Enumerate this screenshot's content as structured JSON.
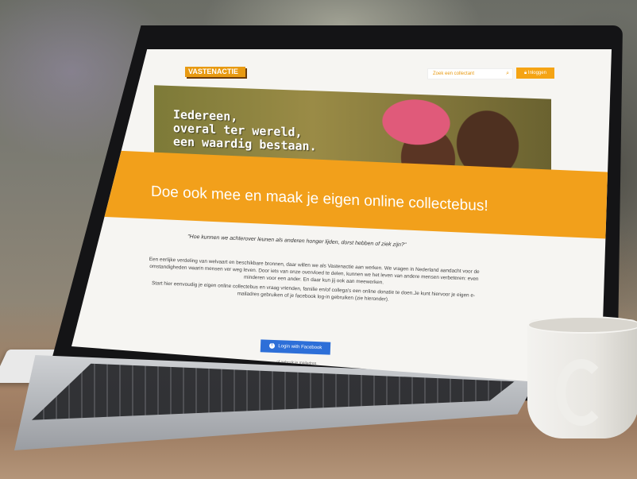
{
  "site": {
    "logo_text": "VASTENACTIE",
    "search_placeholder": "Zoek een collectant",
    "login_label": "Inloggen"
  },
  "hero": {
    "line1": "Iedereen,",
    "line2": "overal ter wereld,",
    "line3": "een waardig bestaan."
  },
  "headline": "Doe ook mee en maak je eigen online collectebus!",
  "quote": "\"Hoe kunnen we achterover leunen als anderen honger lijden, dorst hebben of ziek zijn?\"",
  "body_text": {
    "paragraph1": "Een eerlijke verdeling van welvaart en beschikbare bronnen, daar willen we als Vastenactie aan werken. We vragen in Nederland aandacht voor de omstandigheden waarin mensen ver weg leven. Door iets van onze overvloed te delen, kunnen we het leven van andere mensen verbeteren: even minderen voor een ander. En daar kun jij ook aan meewerken.",
    "paragraph2": "Start hier eenvoudig je eigen online collectebus en vraag vrienden, familie en/of collega's een online donatie te doen.Je kunt hiervoor je eigen e-mailadres gebruiken of je facebook log-in gebruiken (zie hieronder)."
  },
  "facebook_button": "Login with Facebook",
  "alt_link": "of gebruik je mailadres",
  "icons": {
    "search": "search-icon",
    "lock": "lock-icon",
    "facebook": "facebook-icon"
  },
  "colors": {
    "brand_orange": "#f2a01b",
    "facebook_blue": "#2d6fd8"
  }
}
